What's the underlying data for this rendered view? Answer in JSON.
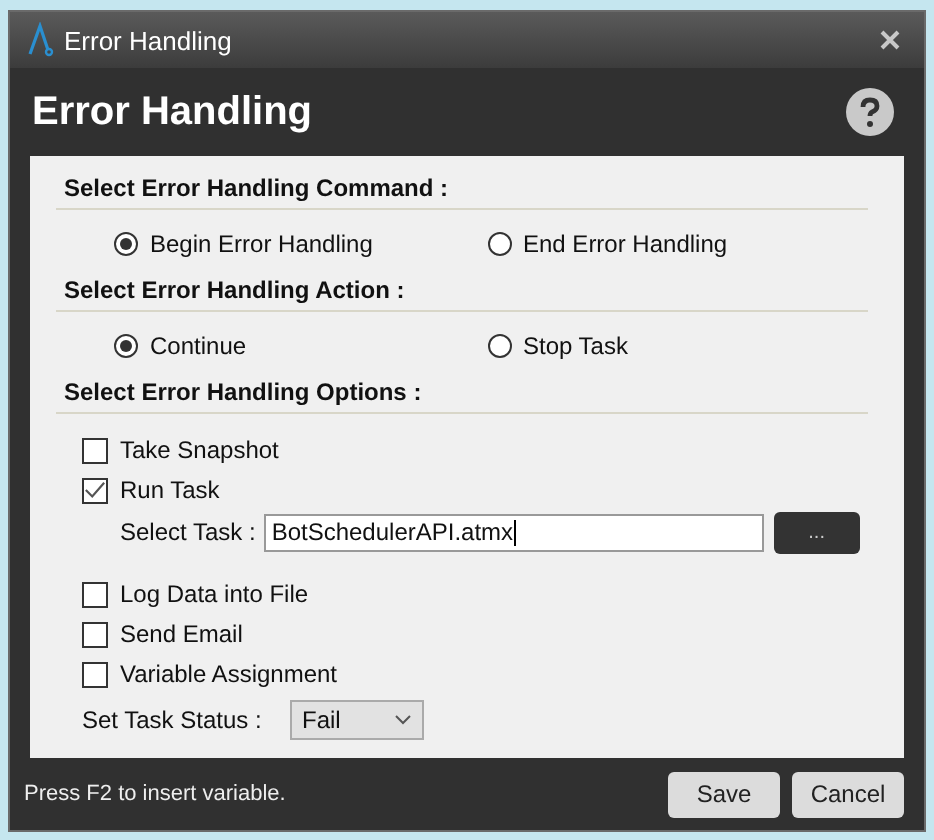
{
  "window": {
    "title": "Error Handling"
  },
  "heading": "Error Handling",
  "radio_sections": [
    {
      "title": "Select Error Handling Command :",
      "options": [
        {
          "label": "Begin Error Handling",
          "selected": true
        },
        {
          "label": "End Error Handling",
          "selected": false
        }
      ]
    },
    {
      "title": "Select Error Handling Action :",
      "options": [
        {
          "label": "Continue",
          "selected": true
        },
        {
          "label": "Stop Task",
          "selected": false
        }
      ]
    }
  ],
  "options_section": {
    "title": "Select Error Handling Options :",
    "items": [
      {
        "kind": "checkbox",
        "label": "Take Snapshot",
        "checked": false
      },
      {
        "kind": "checkbox",
        "label": "Run Task",
        "checked": true
      },
      {
        "kind": "file",
        "label": "Select Task :",
        "value": "BotSchedulerAPI.atmx",
        "button": "..."
      },
      {
        "kind": "checkbox",
        "label": "Log Data into File",
        "checked": false
      },
      {
        "kind": "checkbox",
        "label": "Send Email",
        "checked": false
      },
      {
        "kind": "checkbox",
        "label": "Variable Assignment",
        "checked": false
      },
      {
        "kind": "dropdown",
        "label": "Set Task Status :",
        "value": "Fail"
      }
    ]
  },
  "footer": {
    "hint": "Press F2 to insert variable.",
    "buttons": [
      "Save",
      "Cancel"
    ]
  }
}
